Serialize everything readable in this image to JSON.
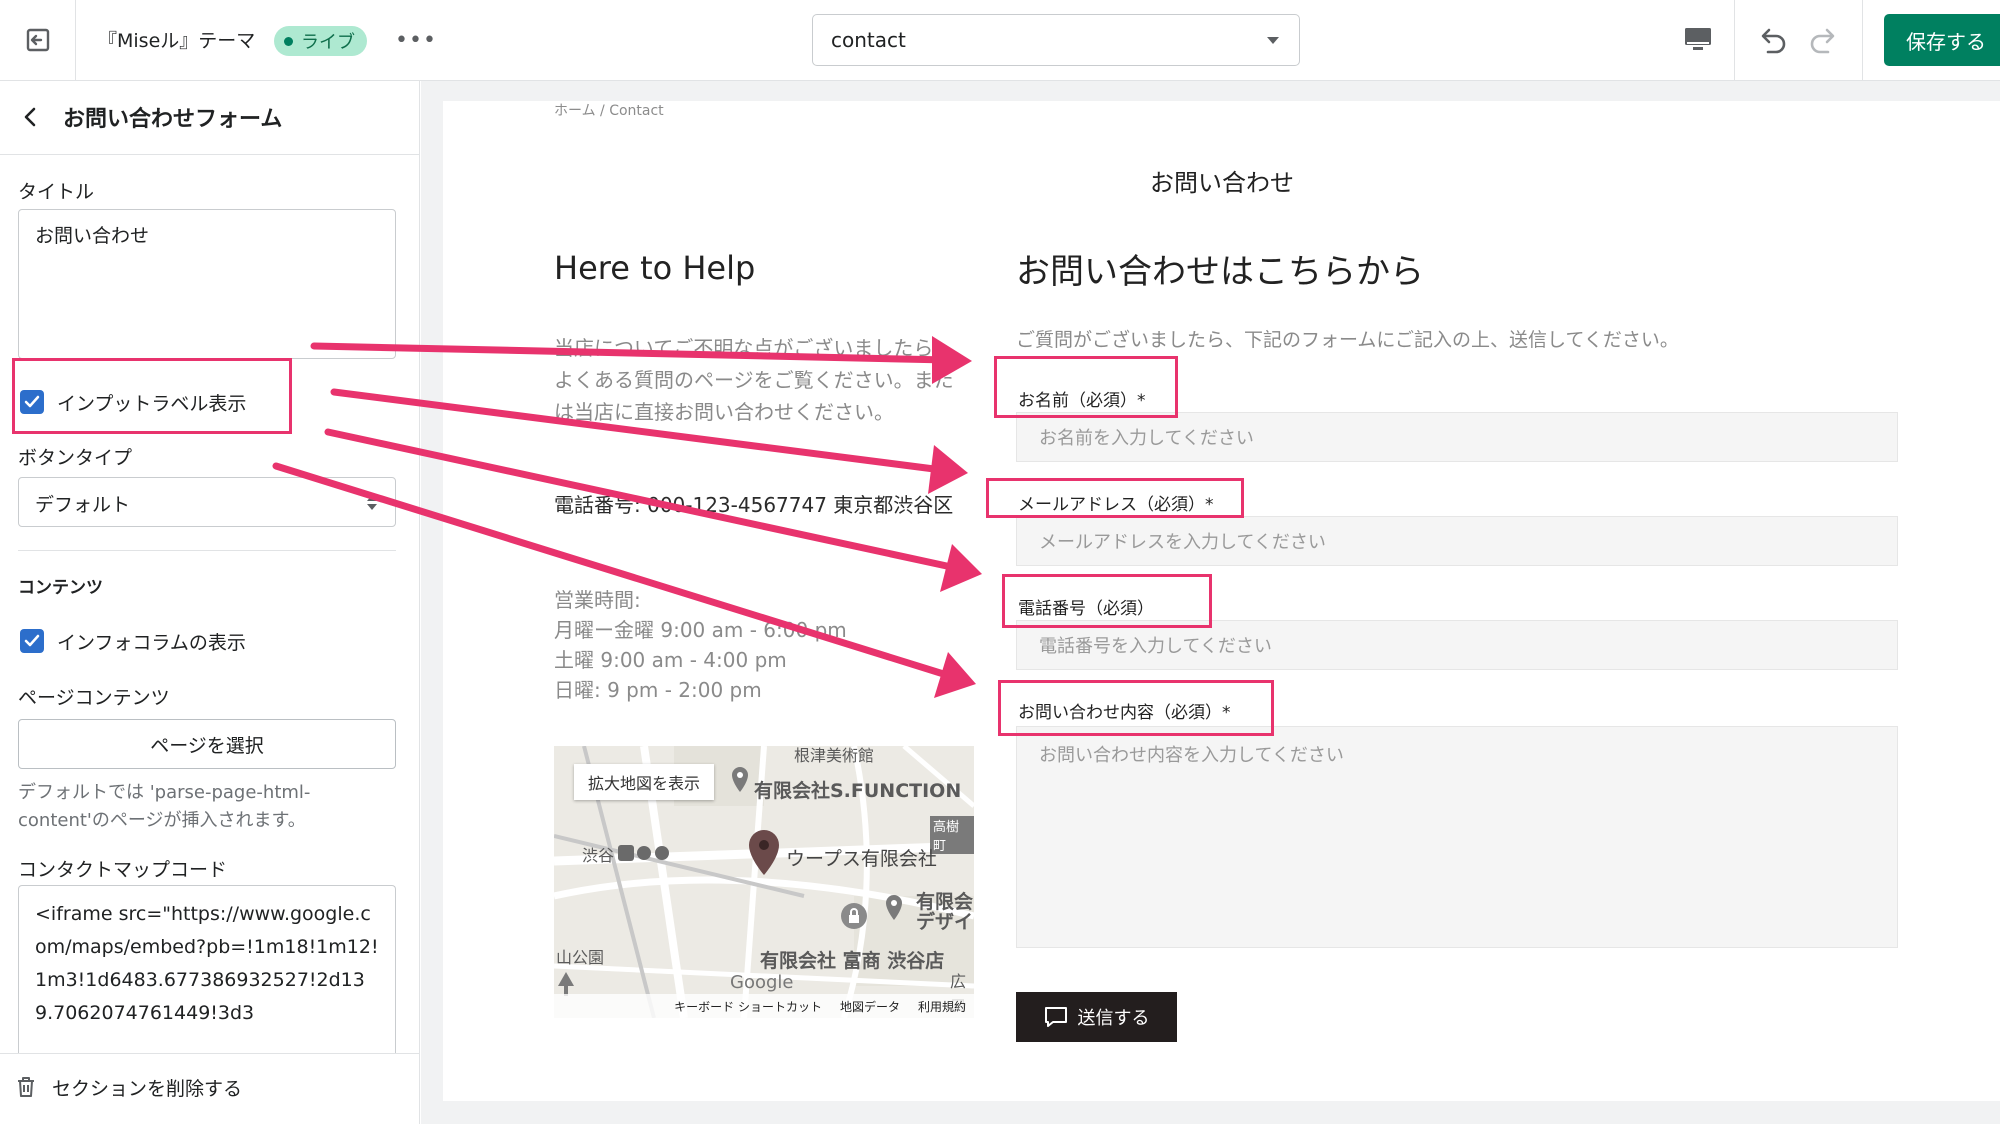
{
  "topbar": {
    "theme_name": "『Miseル』テーマ",
    "live_badge": "ライブ",
    "more_label": "•••",
    "page_select_value": "contact",
    "save_label": "保存する"
  },
  "sidebar": {
    "title": "お問い合わせフォーム",
    "title_field_label": "タイトル",
    "title_field_value": "お問い合わせ",
    "input_label_toggle": "インプットラベル表示",
    "button_type_label": "ボタンタイプ",
    "button_type_value": "デフォルト",
    "content_heading": "コンテンツ",
    "info_column_toggle": "インフォコラムの表示",
    "page_content_label": "ページコンテンツ",
    "page_select_button": "ページを選択",
    "page_content_help": "デフォルトでは 'parse-page-html-content'のページが挿入されます。",
    "map_code_label": "コンタクトマップコード",
    "map_code_value": "<iframe src=\"https://www.google.com/maps/embed?pb=!1m18!1m12!1m3!1d6483.677386932527!2d139.7062074761449!3d3",
    "delete_section": "セクションを削除する"
  },
  "preview": {
    "breadcrumb": "ホーム  /  Contact",
    "page_heading": "お問い合わせ",
    "help_title": "Here to Help",
    "info_text": "当店についてご不明な点がございましたら、よくある質問のページをご覧ください。または当店に直接お問い合わせください。",
    "phone_text": "電話番号: 000-123-4567747 東京都渋谷区",
    "hours": [
      "営業時間:",
      "月曜ー金曜 9:00 am - 6:00 pm",
      "土曜 9:00 am - 4:00 pm",
      "日曜: 9 pm - 2:00 pm"
    ],
    "form_title": "お問い合わせはこちらから",
    "form_desc": "ご質問がございましたら、下記のフォームにご記入の上、送信してください。",
    "fields": [
      {
        "label": "お名前（必須）*",
        "placeholder": "お名前を入力してください"
      },
      {
        "label": "メールアドレス（必須）*",
        "placeholder": "メールアドレスを入力してください"
      },
      {
        "label": "電話番号（必須）",
        "placeholder": "電話番号を入力してください"
      },
      {
        "label": "お問い合わせ内容（必須）*",
        "placeholder": "お問い合わせ内容を入力してください"
      }
    ],
    "submit_label": "送信する",
    "map": {
      "expand_button": "拡大地図を表示",
      "label_museum": "根津美術館",
      "label_sfunction": "有限会社S.FUNCTION",
      "label_takaki": "高樹町",
      "label_shibuya": "渋谷",
      "label_woops": "ウープス有限会社",
      "label_design": "有限会\nデザイ",
      "label_tomita": "有限会社 富商 渋谷店",
      "label_park": "山公園",
      "label_hiro": "広口",
      "logo": "Google",
      "footer_shortcuts": "キーボード ショートカット",
      "footer_mapdata": "地図データ",
      "footer_terms": "利用規約"
    }
  },
  "colors": {
    "accent_green": "#008060",
    "annotation_pink": "#e8336d",
    "checkbox_blue": "#2c6ecb"
  }
}
